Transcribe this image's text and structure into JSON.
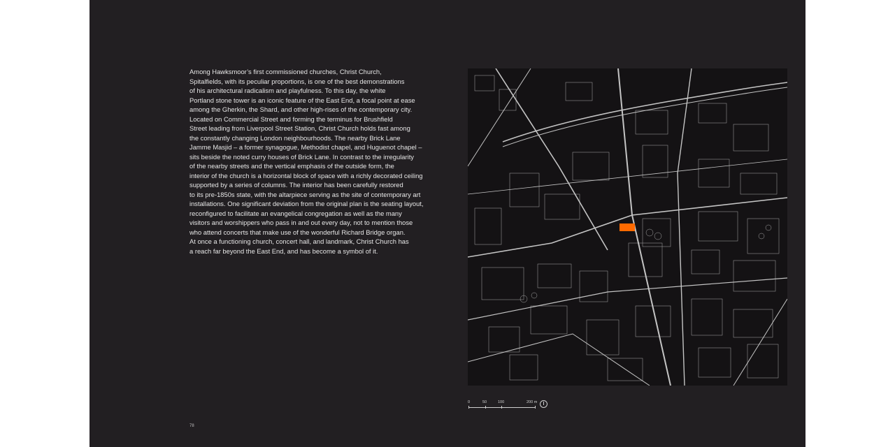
{
  "text": {
    "lines": [
      "Among Hawksmoor’s first commissioned churches, Christ Church,",
      "Spitalfields, with its peculiar proportions, is one of the best demonstrations",
      "of his architectural radicalism and playfulness. To this day, the white",
      "Portland stone tower is an iconic feature of the East End, a focal point at ease",
      "among the Gherkin, the Shard, and other high-rises of the contemporary city.",
      "Located on Commercial Street and forming the terminus for Brushfield",
      "Street leading from Liverpool Street Station, Christ Church holds fast among",
      "the constantly changing London neighbourhoods. The nearby Brick Lane",
      "Jamme Masjid – a former synagogue, Methodist chapel, and Huguenot chapel –",
      "sits beside the noted curry houses of Brick Lane. In contrast to the irregularity",
      "of the nearby streets and the vertical emphasis of the outside form, the",
      "interior of the church is a horizontal block of space with a richly decorated ceiling",
      "supported by a series of columns. The interior has been carefully restored",
      "to its pre-1850s state, with the altarpiece serving as the site of contemporary art",
      "installations. One significant deviation from the original plan is the seating layout,",
      "reconfigured to facilitate an evangelical congregation as well as the many",
      "visitors and worshippers who pass in and out every day, not to mention those",
      "who attend concerts that make use of the wonderful Richard Bridge organ.",
      "At once a functioning church, concert hall, and landmark, Christ Church has",
      "a reach far beyond the East End, and has become a symbol of it."
    ]
  },
  "page_number": "78",
  "scalebar": {
    "labels": [
      "0",
      "50",
      "100",
      "200 m"
    ]
  },
  "colors": {
    "background": "#221f22",
    "map_lines": "#d8d8d8",
    "highlight": "#ff6a00"
  },
  "icons": {
    "north": "north-arrow-icon"
  }
}
